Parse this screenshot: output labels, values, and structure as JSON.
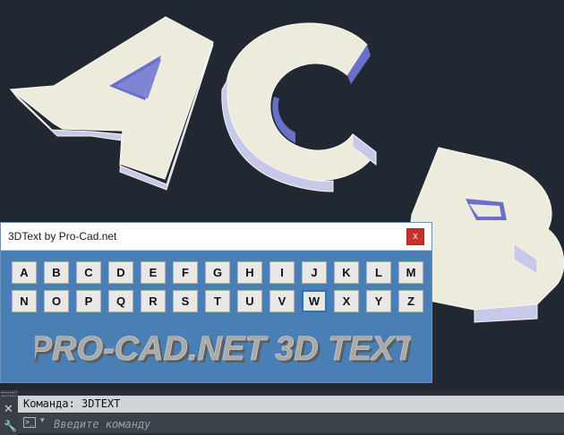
{
  "dialog": {
    "title": "3DText by Pro-Cad.net",
    "close_label": "x",
    "row1": [
      "A",
      "B",
      "C",
      "D",
      "E",
      "F",
      "G",
      "H",
      "I",
      "J",
      "K",
      "L",
      "M"
    ],
    "row2": [
      "N",
      "O",
      "P",
      "Q",
      "R",
      "S",
      "T",
      "U",
      "V",
      "W",
      "X",
      "Y",
      "Z"
    ],
    "selected_letter": "W",
    "banner": "PRO-CAD.NET 3D TEXT"
  },
  "scene": {
    "letters": [
      "A",
      "C",
      "B"
    ],
    "face_color": "#ecebdc",
    "side_color": "#c8c8ea",
    "inner_side_color": "#6a6fc8",
    "background": "#222832"
  },
  "command": {
    "history": "Команда: 3DTEXT",
    "placeholder": "Введите команду",
    "close_icon": "close-icon",
    "settings_icon": "wrench-icon"
  }
}
